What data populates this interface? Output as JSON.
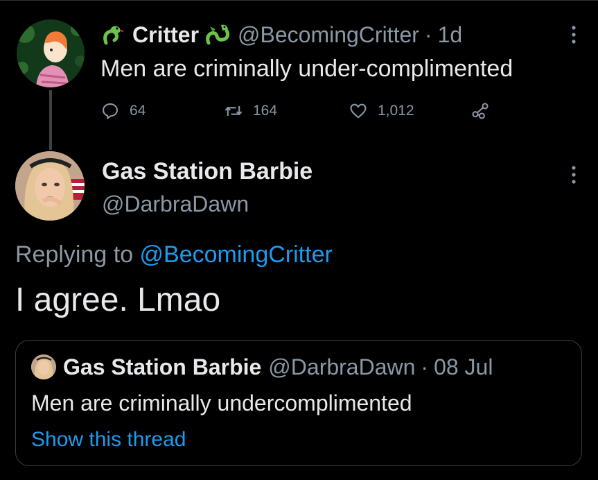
{
  "tweet1": {
    "name": "Critter",
    "handle": "@BecomingCritter",
    "separator": "·",
    "time": "1d",
    "text": "Men are criminally under-complimented",
    "replies": "64",
    "retweets": "164",
    "likes": "1,012"
  },
  "tweet2": {
    "name": "Gas Station Barbie",
    "handle": "@DarbraDawn",
    "replying_prefix": "Replying to ",
    "replying_handle": "@BecomingCritter",
    "text": "I agree. Lmao"
  },
  "quote": {
    "name": "Gas Station Barbie",
    "handle": "@DarbraDawn",
    "separator": "·",
    "date": "08 Jul",
    "text": "Men are criminally undercomplimented",
    "show_thread": "Show this thread"
  },
  "colors": {
    "background": "#000000",
    "text": "#e7e9ea",
    "secondary": "#8b98a5",
    "link": "#1d9bf0",
    "emoji_green": "#6cc24a"
  }
}
